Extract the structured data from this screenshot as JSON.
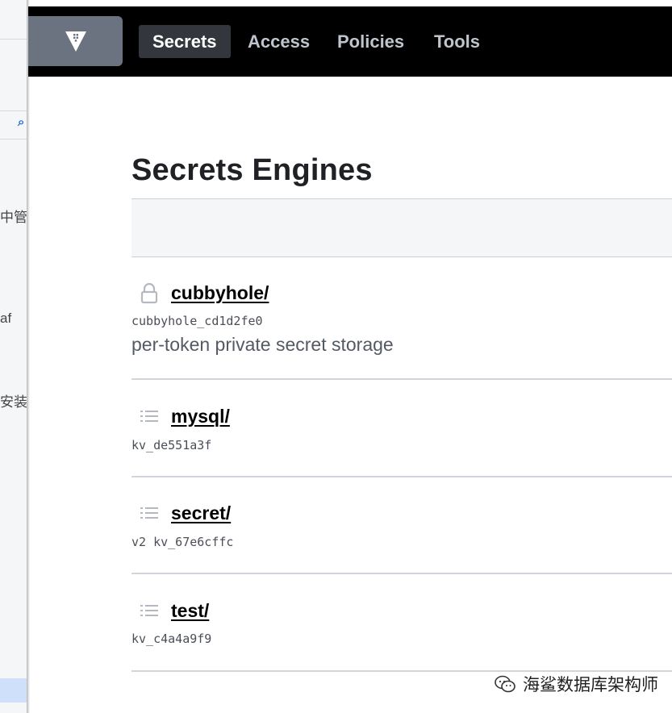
{
  "background_window": {
    "fragments": [
      "中管",
      "af",
      "安装"
    ]
  },
  "nav": {
    "logo_icon": "vault-logo-icon",
    "items": [
      {
        "label": "Secrets",
        "active": true
      },
      {
        "label": "Access",
        "active": false
      },
      {
        "label": "Policies",
        "active": false
      },
      {
        "label": "Tools",
        "active": false
      }
    ]
  },
  "page": {
    "title": "Secrets Engines"
  },
  "engines": [
    {
      "name": "cubbyhole/",
      "accessor": "cubbyhole_cd1d2fe0",
      "description": "per-token private secret storage",
      "icon": "lock-icon"
    },
    {
      "name": "mysql/",
      "accessor": "kv_de551a3f",
      "description": "",
      "icon": "list-icon"
    },
    {
      "name": "secret/",
      "accessor": "v2 kv_67e6cffc",
      "description": "",
      "icon": "list-icon"
    },
    {
      "name": "test/",
      "accessor": "kv_c4a4a9f9",
      "description": "",
      "icon": "list-icon"
    }
  ],
  "watermark": {
    "text": "海鲨数据库架构师"
  },
  "colors": {
    "nav_bg": "#000000",
    "nav_active_bg": "#33373d",
    "logo_bg": "#6b7380",
    "link": "#000000"
  }
}
